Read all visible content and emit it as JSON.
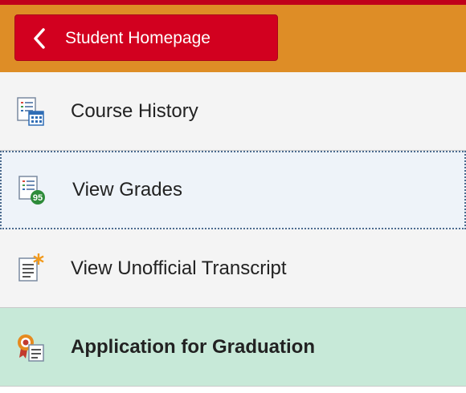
{
  "colors": {
    "top_accent": "#c0001b",
    "header_bg": "#de8d26",
    "back_button_bg": "#d2001f",
    "nav_bg": "#f4f4f4",
    "focused_bg": "#eef3f9",
    "active_bg": "#c7e9d8"
  },
  "header": {
    "back_button_label": "Student Homepage",
    "back_icon": "chevron-left-icon"
  },
  "nav": {
    "items": [
      {
        "label": "Course History",
        "icon": "course-history-icon",
        "state": "normal"
      },
      {
        "label": "View Grades",
        "icon": "grades-icon",
        "badge": "95",
        "state": "focused"
      },
      {
        "label": "View Unofficial Transcript",
        "icon": "transcript-icon",
        "state": "normal"
      },
      {
        "label": "Application for Graduation",
        "icon": "graduation-icon",
        "state": "active"
      }
    ]
  }
}
